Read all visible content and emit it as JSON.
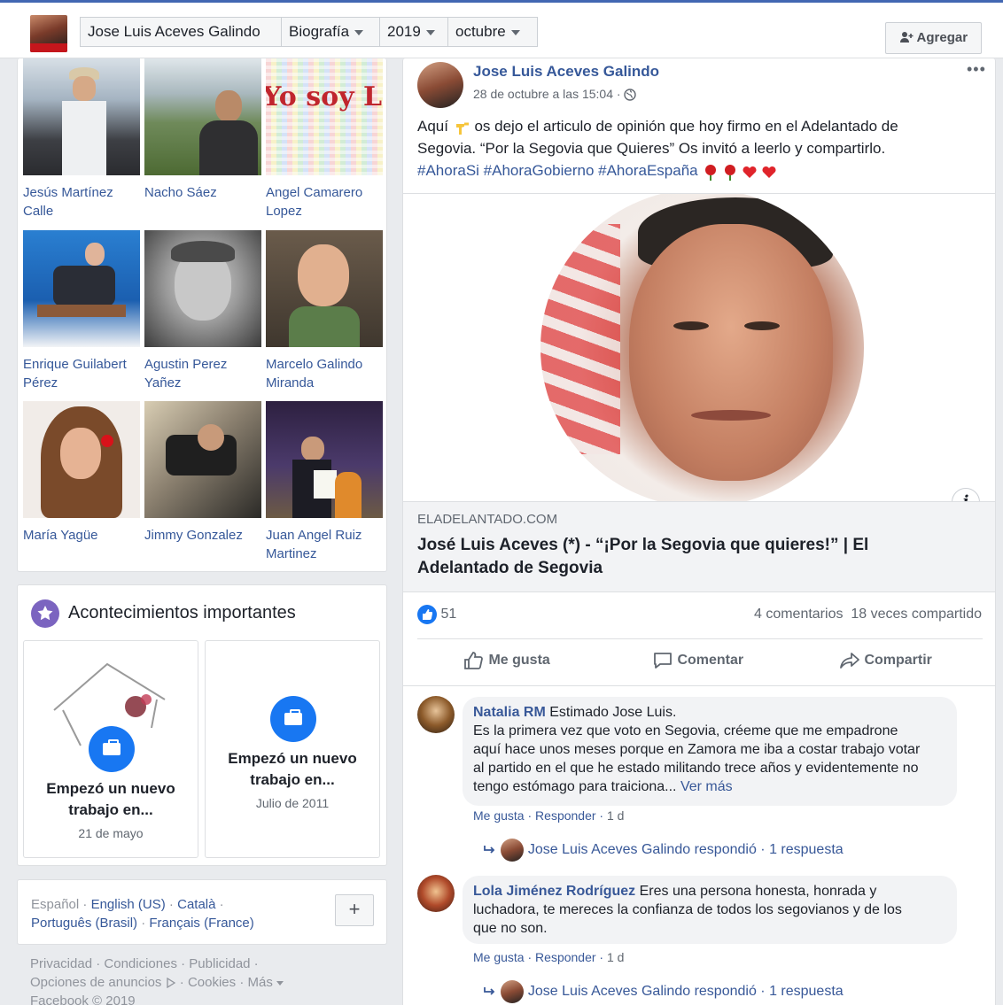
{
  "header": {
    "profile_name": "Jose Luis Aceves Galindo",
    "section": "Biografía",
    "year": "2019",
    "month": "octubre",
    "add_button": "Agregar"
  },
  "friends": [
    {
      "name": "Jesús Martínez Calle",
      "line1": "Jesús Martínez",
      "line2": "Calle"
    },
    {
      "name": "Nacho Sáez",
      "line1": "Nacho Sáez",
      "line2": ""
    },
    {
      "name": "Angel Camarero Lopez",
      "line1": "Angel Camarero",
      "line2": "Lopez"
    },
    {
      "name": "Enrique Guilabert Pérez",
      "line1": "Enrique Guilabert",
      "line2": "Pérez"
    },
    {
      "name": "Agustin Perez Yañez",
      "line1": "Agustin Perez",
      "line2": "Yañez"
    },
    {
      "name": "Marcelo Galindo Miranda",
      "line1": "Marcelo Galindo",
      "line2": "Miranda"
    },
    {
      "name": "María Yagüe",
      "line1": "María Yagüe",
      "line2": ""
    },
    {
      "name": "Jimmy Gonzalez",
      "line1": "Jimmy Gonzalez",
      "line2": ""
    },
    {
      "name": "Juan Angel Ruiz Martinez",
      "line1": "Juan Angel Ruiz",
      "line2": "Martinez"
    }
  ],
  "friend_photo_3_text": "Yo soy Libe",
  "events": {
    "title": "Acontecimientos importantes",
    "items": [
      {
        "line1": "Empezó un nuevo",
        "line2": "trabajo en...",
        "date": "21 de mayo"
      },
      {
        "line1": "Empezó un nuevo",
        "line2": "trabajo en...",
        "date": "Julio de 2011"
      }
    ]
  },
  "languages": {
    "current": "Español",
    "others": [
      "English (US)",
      "Català",
      "Português (Brasil)",
      "Français (France)"
    ],
    "add": "+"
  },
  "footer": {
    "privacy": "Privacidad",
    "terms": "Condiciones",
    "ads": "Publicidad",
    "ad_choices": "Opciones de anuncios",
    "cookies": "Cookies",
    "more": "Más",
    "copyright": "Facebook © 2019"
  },
  "post": {
    "author": "Jose Luis Aceves Galindo",
    "timestamp": "28 de octubre a las 15:04",
    "text_line1_a": "Aquí",
    "text_line1_b": "os dejo el articulo de opinión que hoy firmo en el Adelantado de",
    "text_line2": "Segovia. “Por la Segovia que Quieres” Os invitó a leerlo y compartirlo.",
    "hashtags": "#AhoraSi #AhoraGobierno #AhoraEspaña",
    "link_domain": "ELADELANTADO.COM",
    "link_title_line1": "José Luis Aceves (*) - “¡Por la Segovia que quieres!” | El",
    "link_title_line2": "Adelantado de Segovia",
    "info_glyph": "i",
    "likes": "51",
    "comments_count": "4 comentarios",
    "shares": "18 veces compartido",
    "actions": {
      "like": "Me gusta",
      "comment": "Comentar",
      "share": "Compartir"
    }
  },
  "comments": [
    {
      "author": "Natalia RM",
      "lines": [
        "Estimado Jose Luis.",
        "Es la primera vez que voto en Segovia, créeme que me empadrone",
        "aquí hace unos meses porque en Zamora me iba a costar trabajo votar",
        "al partido en el que he estado militando trece años y evidentemente no",
        "tengo estómago para traiciona..."
      ],
      "see_more": "Ver más",
      "like": "Me gusta",
      "reply": "Responder",
      "age": "1 d",
      "reply_summary": "Jose Luis Aceves Galindo respondió",
      "reply_count": "1 respuesta"
    },
    {
      "author": "Lola Jiménez Rodríguez",
      "lines": [
        "Eres una persona honesta, honrada y",
        "luchadora, te mereces la confianza de todos los segovianos y de los",
        "que no son."
      ],
      "like": "Me gusta",
      "reply": "Responder",
      "age": "1 d",
      "reply_summary": "Jose Luis Aceves Galindo respondió",
      "reply_count": "1 respuesta"
    }
  ]
}
